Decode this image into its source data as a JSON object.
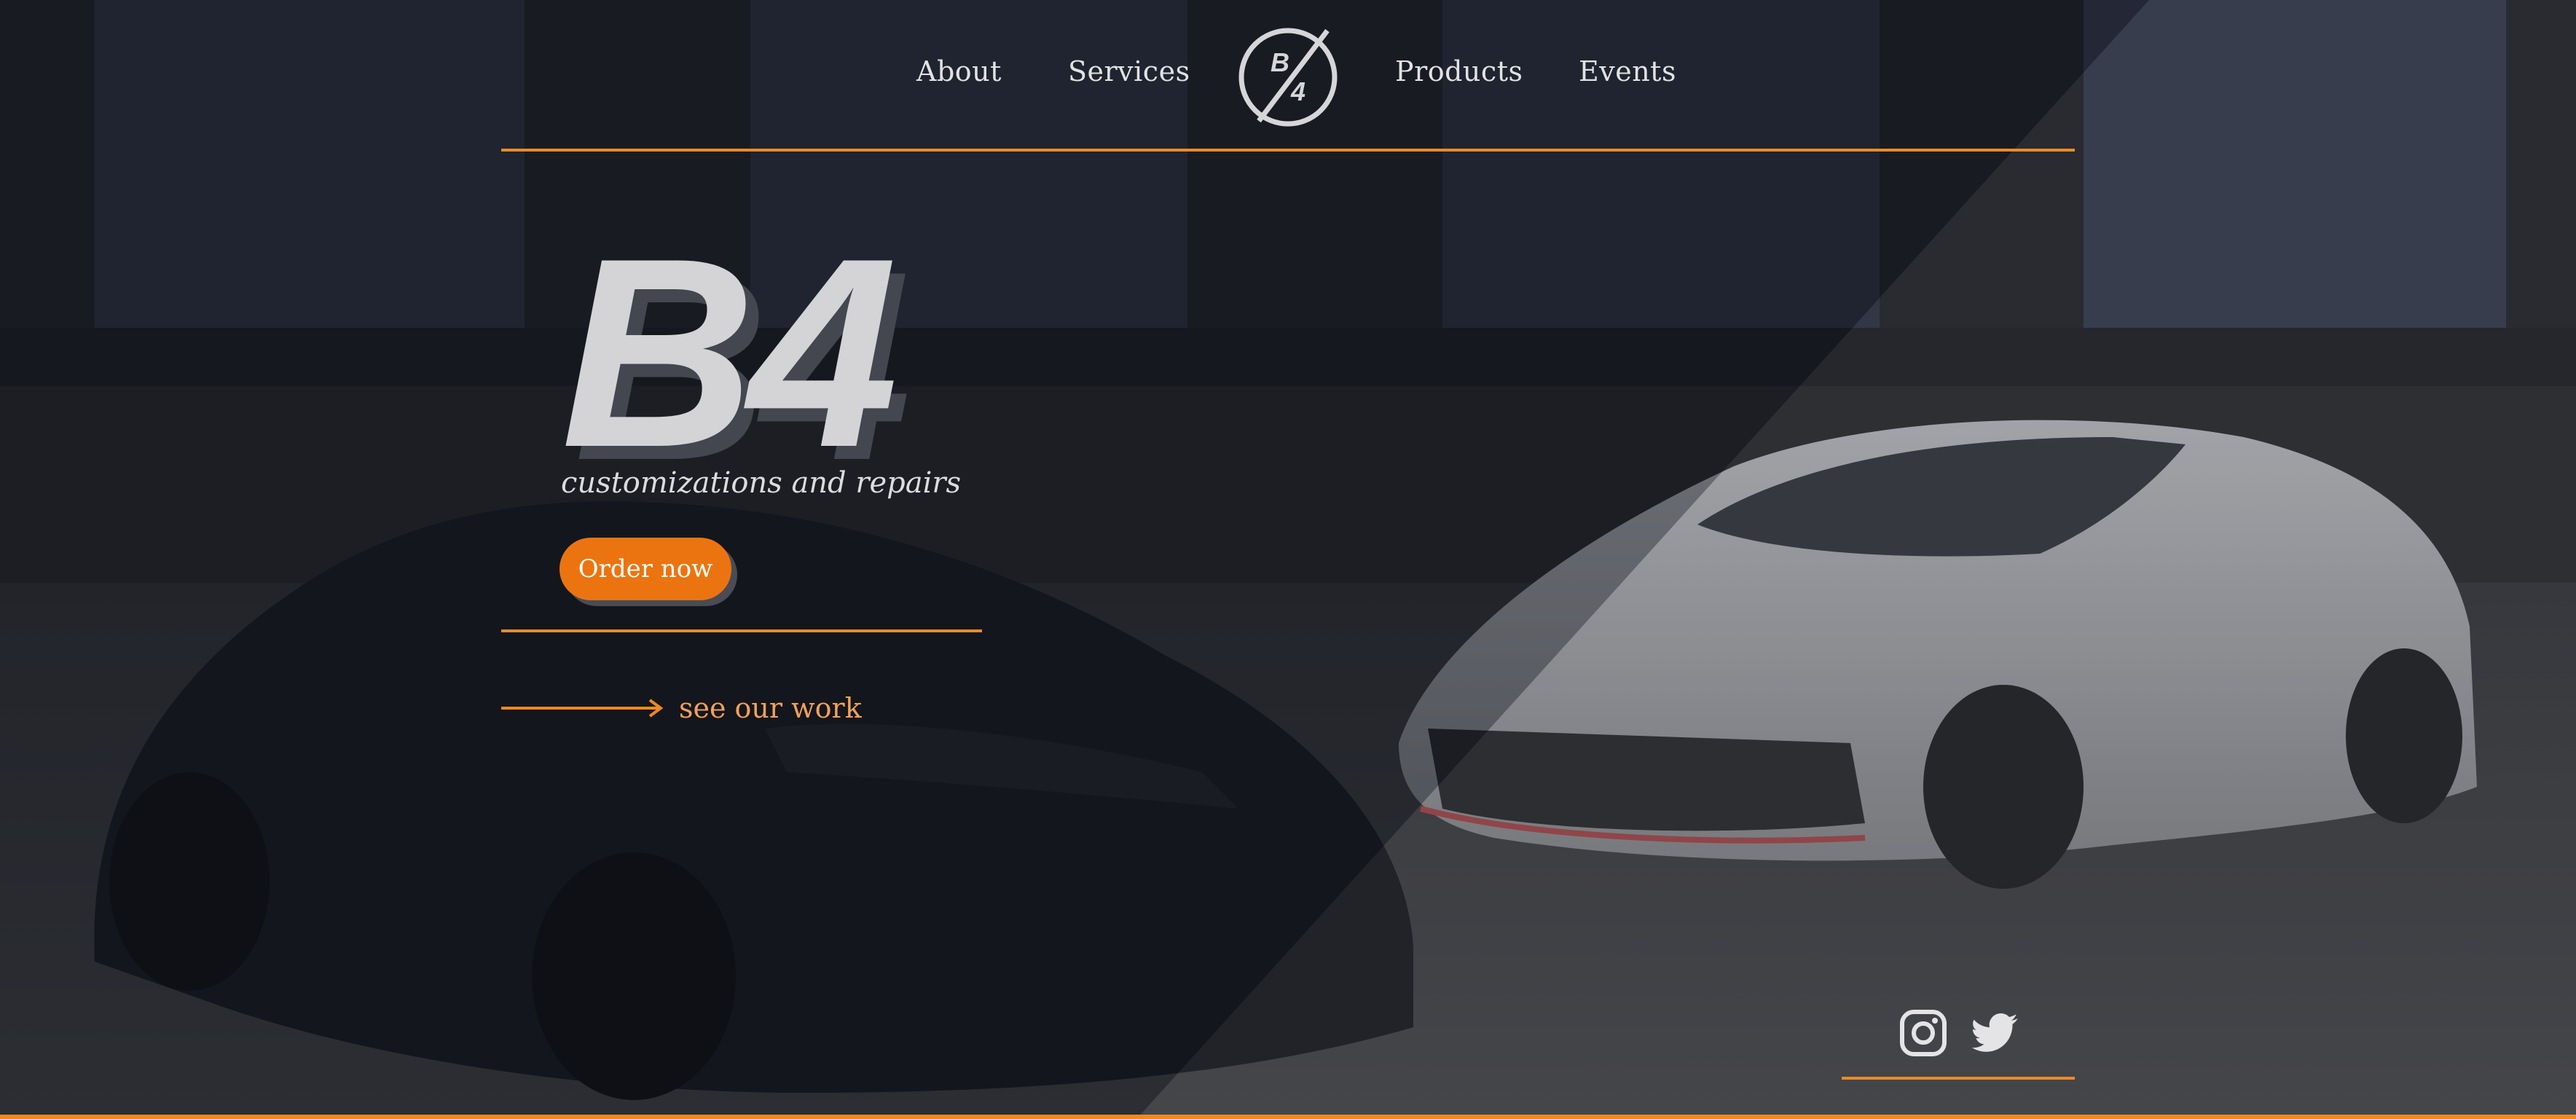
{
  "nav": {
    "items": [
      {
        "label": "About"
      },
      {
        "label": "Services"
      },
      {
        "label": "Products"
      },
      {
        "label": "Events"
      }
    ],
    "logo": {
      "top": "B",
      "bottom": "4"
    }
  },
  "hero": {
    "title": "B4",
    "subtitle": "customizations and repairs",
    "order_button": "Order now",
    "see_work": "see our work"
  },
  "social": {
    "icons": [
      "instagram-icon",
      "twitter-icon"
    ]
  },
  "colors": {
    "accent": "#ee8a1f",
    "button": "#ec7410",
    "link": "#f1a25a",
    "text": "#e2e2e2",
    "background": "#1b1d22"
  }
}
